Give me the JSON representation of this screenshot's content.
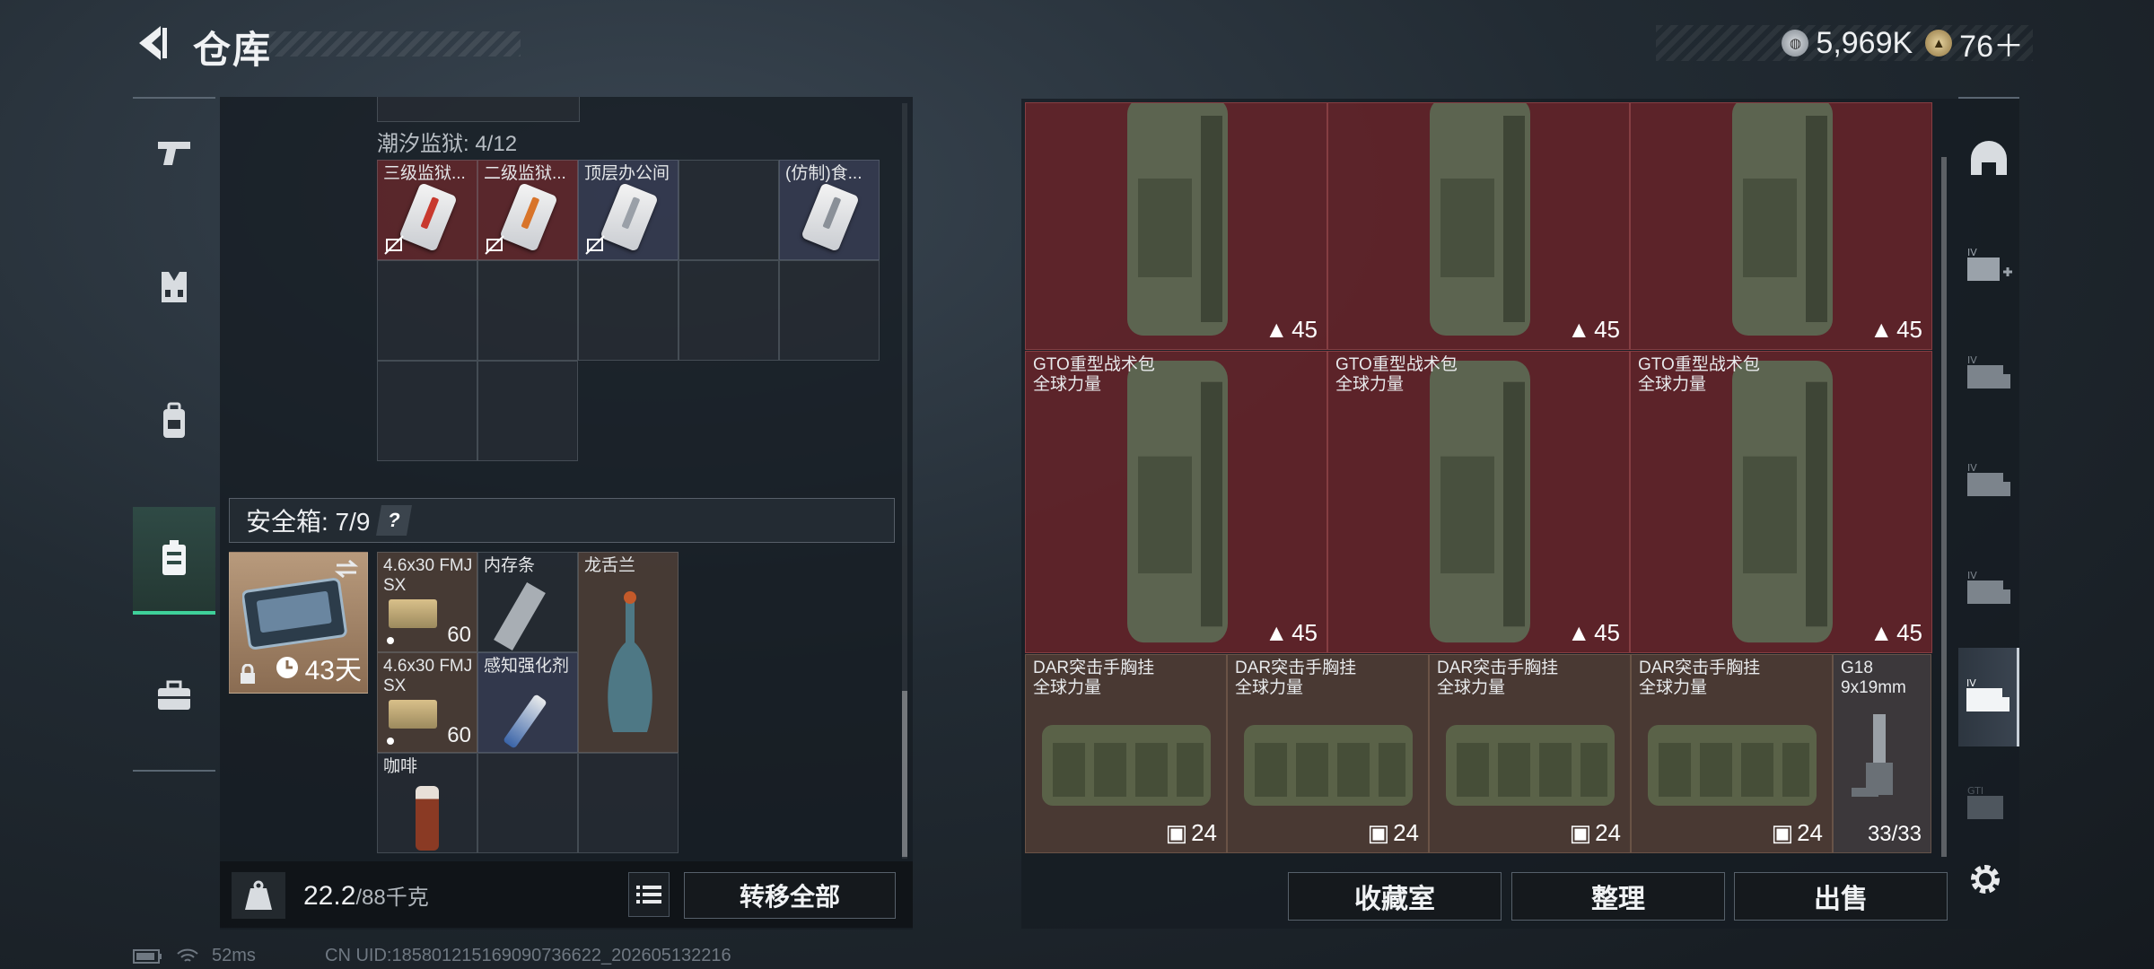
{
  "header": {
    "title": "仓库",
    "currency_primary": "5,969K",
    "currency_secondary": "76＋"
  },
  "left_nav": {
    "items": [
      {
        "icon": "pistol-icon"
      },
      {
        "icon": "vest-icon"
      },
      {
        "icon": "backpack-icon"
      },
      {
        "icon": "safe-case-icon",
        "active": true
      },
      {
        "icon": "briefcase-icon"
      }
    ]
  },
  "collection": {
    "label": "潮汐监狱: 4/12",
    "cells": [
      {
        "label": "三级监狱...",
        "color": "red"
      },
      {
        "label": "二级监狱...",
        "color": "red"
      },
      {
        "label": "顶层办公间",
        "color": "blue"
      },
      {
        "label": "",
        "color": "empty"
      },
      {
        "label": "(仿制)食...",
        "color": "blue"
      }
    ]
  },
  "safe": {
    "label": "安全箱: 7/9",
    "help": "?",
    "days": "43天",
    "items": [
      {
        "label": "4.6x30 FMJ SX",
        "count": "60"
      },
      {
        "label": "内存条",
        "count": ""
      },
      {
        "label": "龙舌兰",
        "count": ""
      },
      {
        "label": "4.6x30 FMJ SX",
        "count": "60"
      },
      {
        "label": "感知强化剂",
        "count": ""
      },
      {
        "label": "咖啡",
        "count": ""
      }
    ]
  },
  "weight": {
    "current": "22.2",
    "max": "/88千克"
  },
  "buttons": {
    "transfer_all": "转移全部",
    "collection_room": "收藏室",
    "organize": "整理",
    "sell": "出售"
  },
  "stash": {
    "backpacks_row1": [
      {
        "label": "",
        "sub": "",
        "count": "45"
      },
      {
        "label": "",
        "sub": "",
        "count": "45"
      },
      {
        "label": "",
        "sub": "",
        "count": "45"
      }
    ],
    "backpacks_row2": [
      {
        "label": "GTO重型战术包",
        "sub": "全球力量",
        "count": "45"
      },
      {
        "label": "GTO重型战术包",
        "sub": "全球力量",
        "count": "45"
      },
      {
        "label": "GTO重型战术包",
        "sub": "全球力量",
        "count": "45"
      }
    ],
    "rigs": [
      {
        "label": "DAR突击手胸挂",
        "sub": "全球力量",
        "count": "24"
      },
      {
        "label": "DAR突击手胸挂",
        "sub": "全球力量",
        "count": "24"
      },
      {
        "label": "DAR突击手胸挂",
        "sub": "全球力量",
        "count": "24"
      },
      {
        "label": "DAR突击手胸挂",
        "sub": "全球力量",
        "count": "24"
      }
    ],
    "gun": {
      "label": "G18",
      "sub": "9x19mm",
      "count": "33/33"
    }
  },
  "right_nav": {
    "items": [
      {
        "icon": "helmet-icon",
        "label": ""
      },
      {
        "icon": "add-storage-icon",
        "label": "IV"
      },
      {
        "icon": "storage-1-icon",
        "label": "IV"
      },
      {
        "icon": "storage-2-icon",
        "label": "IV"
      },
      {
        "icon": "storage-3-icon",
        "label": "IV"
      },
      {
        "icon": "storage-active-icon",
        "label": "IV",
        "active": true
      },
      {
        "icon": "storage-locked-icon",
        "label": "GTI"
      }
    ]
  },
  "status": {
    "ping": "52ms",
    "uid": "CN UID:185801215169090736622_202605132216"
  },
  "colors": {
    "accent": "#3fd19a",
    "red_cell": "#68242a",
    "brown_cell": "#523e36"
  }
}
